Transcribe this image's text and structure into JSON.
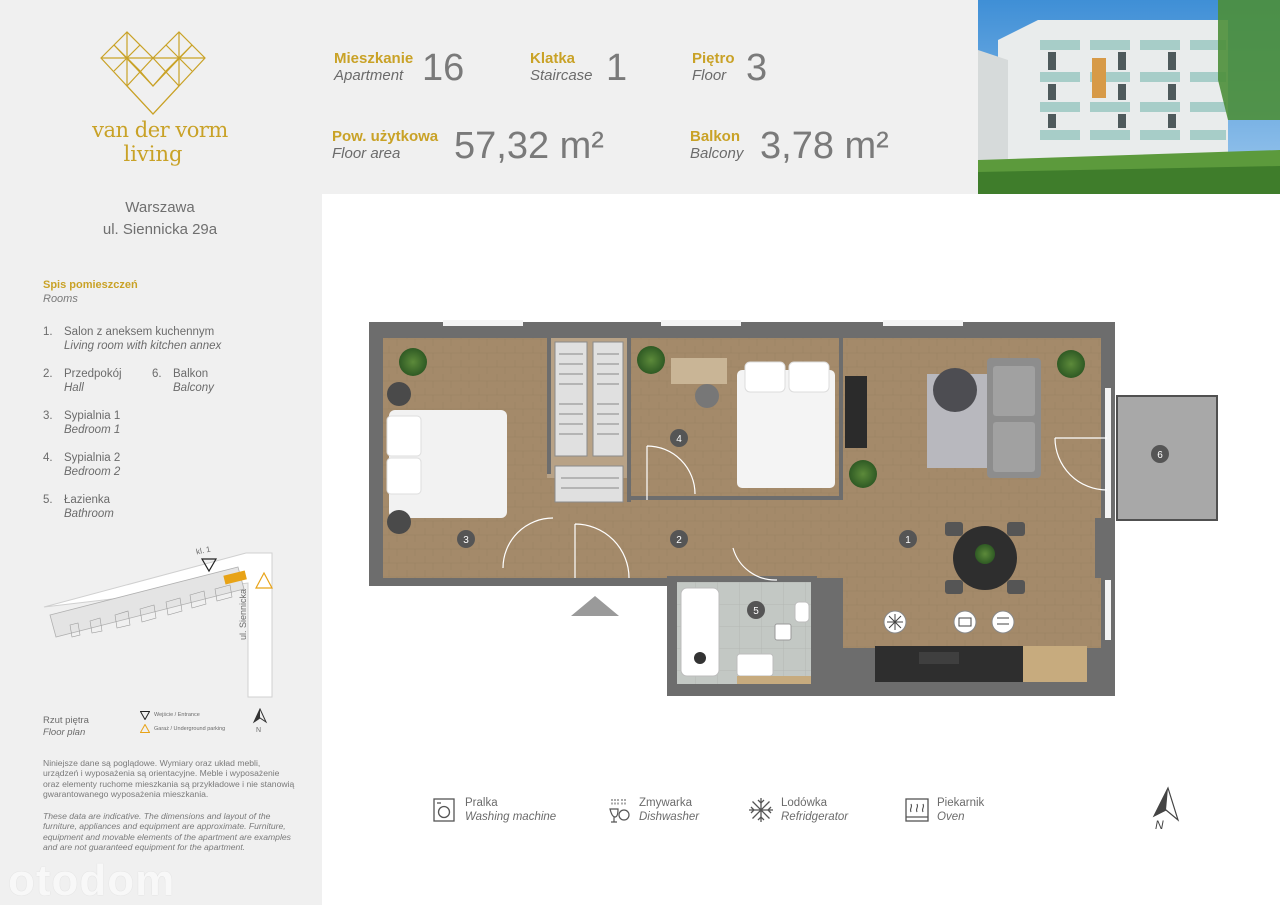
{
  "brand": {
    "name": "van der vorm",
    "sub": "living"
  },
  "address": {
    "city": "Warszawa",
    "street": "ul. Siennicka 29a"
  },
  "rooms": {
    "title_pl": "Spis pomieszczeń",
    "title_en": "Rooms",
    "items": [
      {
        "num": "1.",
        "pl": "Salon z aneksem kuchennym",
        "en": "Living room with kitchen annex"
      },
      {
        "num": "2.",
        "pl": "Przedpokój",
        "en": "Hall"
      },
      {
        "num": "3.",
        "pl": "Sypialnia 1",
        "en": "Bedroom 1"
      },
      {
        "num": "4.",
        "pl": "Sypialnia 2",
        "en": "Bedroom 2"
      },
      {
        "num": "5.",
        "pl": "Łazienka",
        "en": "Bathroom"
      },
      {
        "num": "6.",
        "pl": "Balkon",
        "en": "Balcony"
      }
    ]
  },
  "site_map": {
    "staircase_label": "kl. 1",
    "street_label": "ul. Siennicka",
    "floor_plan_pl": "Rzut piętra",
    "floor_plan_en": "Floor plan",
    "legend_entrance": "Wejście / Entrance",
    "legend_garage": "Garaż / Underground parking",
    "north": "N"
  },
  "disclaimer": {
    "pl": "Niniejsze dane są poglądowe. Wymiary oraz układ mebli, urządzeń i wyposażenia są orientacyjne. Meble i wyposażenie oraz elementy ruchome mieszkania są przykładowe i nie stanowią gwarantowanego wyposażenia mieszkania.",
    "en": "These data are indicative. The dimensions and layout of the furniture, appliances and equipment are approximate. Furniture, equipment and movable elements of the apartment are examples and are not guaranteed equipment for the apartment."
  },
  "watermark": "otodom",
  "stats": {
    "apartment": {
      "pl": "Mieszkanie",
      "en": "Apartment",
      "value": "16"
    },
    "staircase": {
      "pl": "Klatka",
      "en": "Staircase",
      "value": "1"
    },
    "floor": {
      "pl": "Piętro",
      "en": "Floor",
      "value": "3"
    },
    "area": {
      "pl": "Pow. użytkowa",
      "en": "Floor area",
      "value": "57,32 m²"
    },
    "balcony": {
      "pl": "Balkon",
      "en": "Balcony",
      "value": "3,78 m²"
    }
  },
  "plan_numbers": [
    "1",
    "2",
    "3",
    "4",
    "5",
    "6"
  ],
  "appliances": [
    {
      "pl": "Pralka",
      "en": "Washing machine",
      "icon": "washing-machine-icon"
    },
    {
      "pl": "Zmywarka",
      "en": "Dishwasher",
      "icon": "dishwasher-icon"
    },
    {
      "pl": "Lodówka",
      "en": "Refridgerator",
      "icon": "snowflake-icon"
    },
    {
      "pl": "Piekarnik",
      "en": "Oven",
      "icon": "oven-icon"
    }
  ],
  "compass": "N",
  "colors": {
    "gold": "#c9a227",
    "wall": "#6d6d6d",
    "floor_wood": "#a48a6a",
    "panel": "#f0f0f0"
  }
}
